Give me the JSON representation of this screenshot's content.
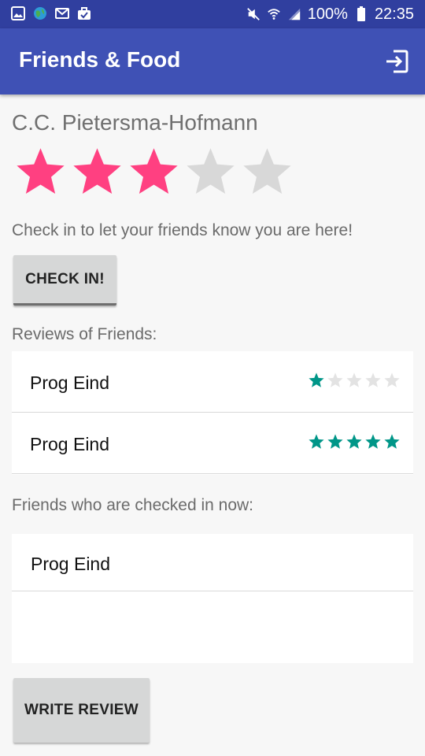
{
  "status_bar": {
    "battery": "100%",
    "time": "22:35",
    "left_icons": [
      "gallery-icon",
      "globe-icon",
      "gmail-icon",
      "briefcase-icon"
    ],
    "right_icons": [
      "mute-icon",
      "wifi-icon",
      "signal-icon",
      "battery-icon"
    ]
  },
  "app_bar": {
    "title": "Friends & Food",
    "action_icon": "logout-icon"
  },
  "restaurant": {
    "name": "C.C. Pietersma-Hofmann",
    "rating": 3,
    "max_rating": 5
  },
  "checkin": {
    "prompt": "Check in to let your friends know you are here!",
    "button_label": "CHECK IN!"
  },
  "reviews": {
    "label": "Reviews of Friends:",
    "items": [
      {
        "name": "Prog Eind",
        "rating": 1
      },
      {
        "name": "Prog Eind",
        "rating": 5
      }
    ]
  },
  "checked_in": {
    "label": "Friends who are checked in now:",
    "items": [
      {
        "name": "Prog Eind"
      }
    ]
  },
  "write_review": {
    "button_label": "WRITE REVIEW"
  },
  "colors": {
    "primary": "#3f51b5",
    "primary_dark": "#303f9f",
    "star_pink": "#ff4081",
    "star_teal": "#009688",
    "star_empty": "#d8d8d8",
    "star_small_empty": "#e3e3e3"
  }
}
